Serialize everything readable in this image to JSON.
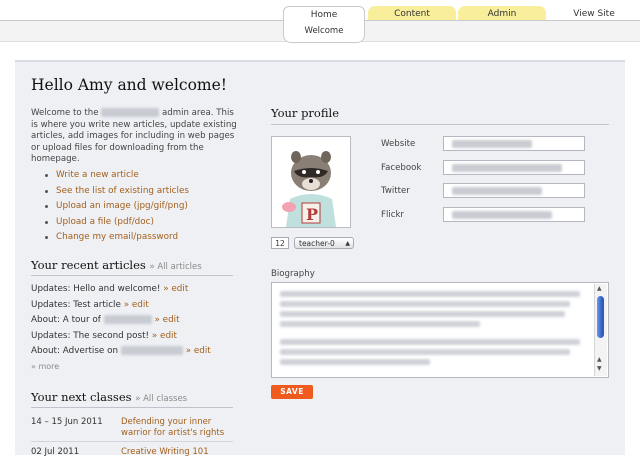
{
  "nav": {
    "tabs": [
      {
        "label": "Home"
      },
      {
        "label": "Content"
      },
      {
        "label": "Admin"
      },
      {
        "label": "View Site"
      }
    ],
    "subtab": "Welcome"
  },
  "greeting": "Hello Amy and welcome!",
  "intro": {
    "pre": "Welcome to the",
    "post": "admin area. This is where you write new articles, update existing articles, add images for including in web pages or upload files for downloading from the homepage."
  },
  "actions": [
    "Write a new article",
    "See the list of existing articles",
    "Upload an image (jpg/gif/png)",
    "Upload a file (pdf/doc)",
    "Change my email/password"
  ],
  "recent": {
    "title": "Your recent articles",
    "all_link": "» All articles",
    "edit": "» edit",
    "items": [
      {
        "prefix": "Updates: Hello and welcome!",
        "suffix": ""
      },
      {
        "prefix": "Updates: Test article",
        "suffix": ""
      },
      {
        "prefix": "About: A tour of",
        "suffix": ""
      },
      {
        "prefix": "Updates: The second post!",
        "suffix": ""
      },
      {
        "prefix": "About: Advertise on",
        "suffix": ""
      }
    ],
    "more": "» more"
  },
  "classes": {
    "title": "Your next classes",
    "all_link": "» All classes",
    "items": [
      {
        "date": "14 – 15 Jun 2011",
        "title": "Defending your inner warrior for artist's rights"
      },
      {
        "date": "02 Jul 2011",
        "title": "Creative Writing 101"
      }
    ]
  },
  "profile": {
    "title": "Your profile",
    "fields": [
      {
        "label": "Website"
      },
      {
        "label": "Facebook"
      },
      {
        "label": "Twitter"
      },
      {
        "label": "Flickr"
      }
    ],
    "size_value": "12",
    "theme_select": "teacher-0",
    "biography_label": "Biography",
    "save_label": "SAVE"
  },
  "colors": {
    "accent_link": "#a35f1c",
    "tab_yellow": "#f8ee9c",
    "save_button": "#ef5a1e",
    "panel_bg": "#eef0f4"
  }
}
